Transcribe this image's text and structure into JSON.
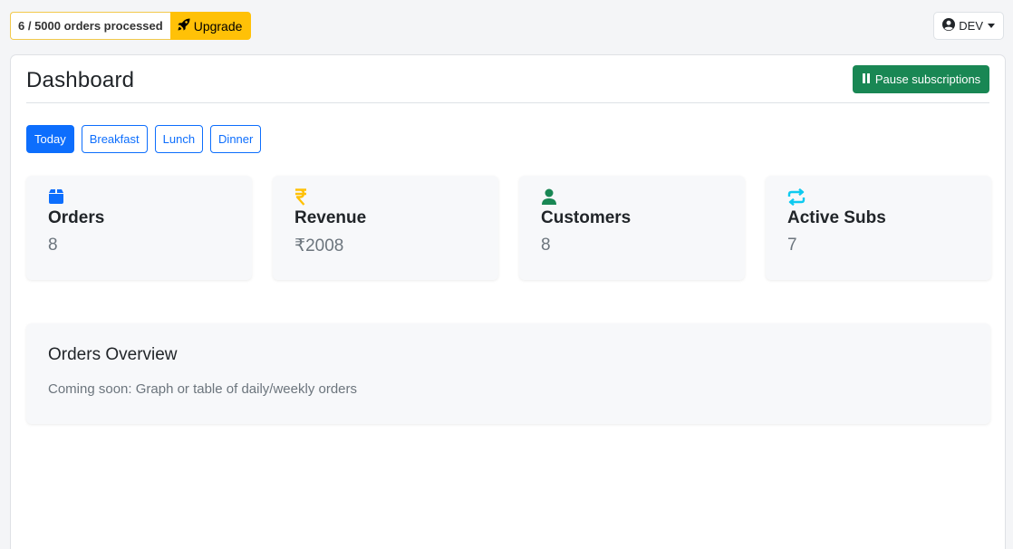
{
  "topbar": {
    "usage_text": "6 / 5000 orders processed",
    "upgrade_label": "Upgrade",
    "user_label": "DEV"
  },
  "header": {
    "title": "Dashboard",
    "pause_label": "Pause subscriptions"
  },
  "filters": [
    "Today",
    "Breakfast",
    "Lunch",
    "Dinner"
  ],
  "active_filter": "Today",
  "stats": [
    {
      "icon": "box-icon",
      "label": "Orders",
      "value": "8",
      "color": "#0d6efd"
    },
    {
      "icon": "rupee-icon",
      "label": "Revenue",
      "value": "₹2008",
      "color": "#ffc107"
    },
    {
      "icon": "person-icon",
      "label": "Customers",
      "value": "8",
      "color": "#198754"
    },
    {
      "icon": "repeat-icon",
      "label": "Active Subs",
      "value": "7",
      "color": "#0dcaf0"
    }
  ],
  "overview": {
    "title": "Orders Overview",
    "text": "Coming soon: Graph or table of daily/weekly orders"
  },
  "colors": {
    "primary": "#0d6efd",
    "success": "#198754",
    "warning": "#ffc107",
    "info": "#0dcaf0"
  }
}
